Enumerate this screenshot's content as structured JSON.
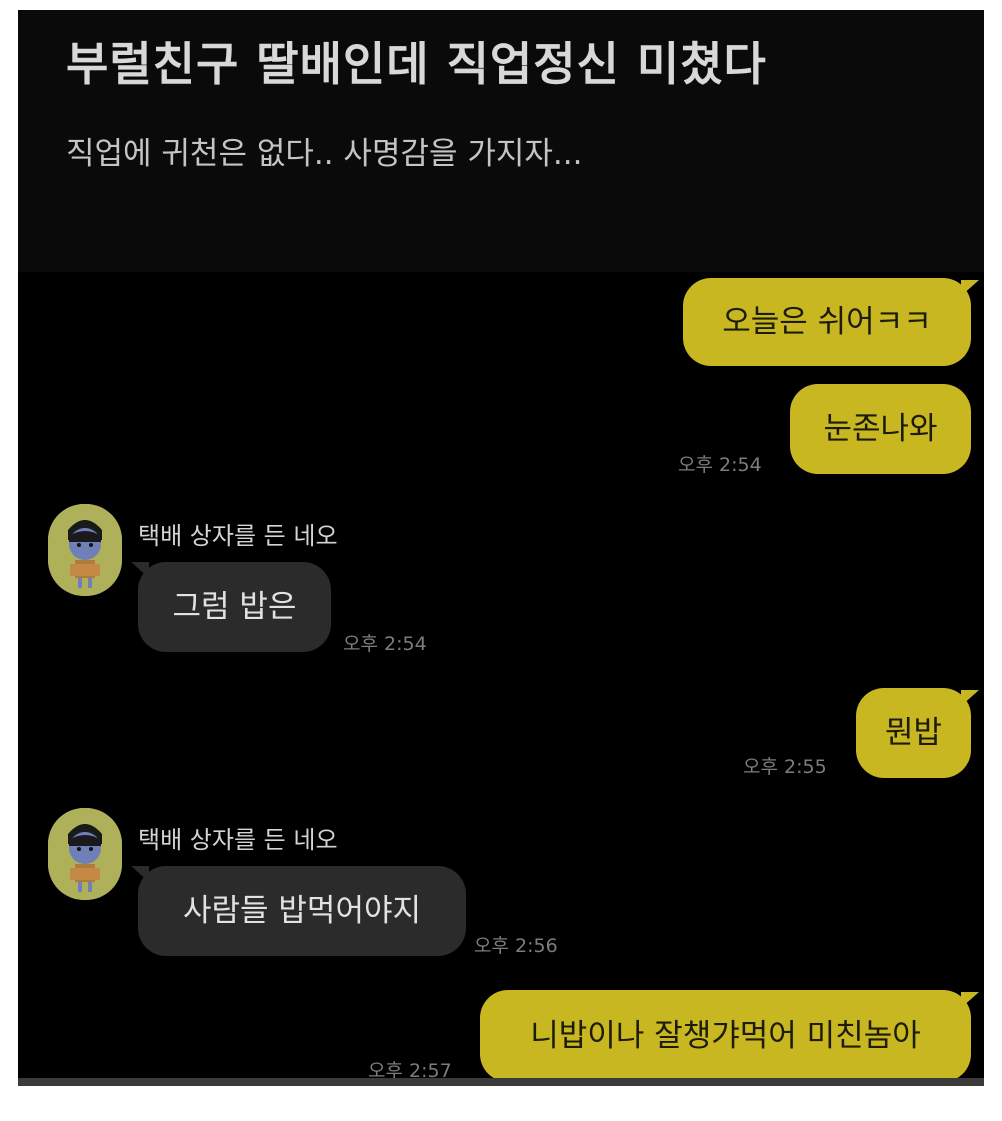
{
  "post": {
    "title": "부럴친구 딸배인데 직업정신 미쳤다",
    "subtitle": "직업에 귀천은 없다.. 사명감을 가지자..."
  },
  "chat": {
    "messages": [
      {
        "from": "me",
        "text": "오늘은 쉬어ㅋㅋ"
      },
      {
        "from": "me",
        "text": "눈존나와",
        "time": "오후 2:54"
      },
      {
        "from": "them",
        "sender": "택배 상자를 든 네오",
        "text": "그럼 밥은",
        "time": "오후 2:54"
      },
      {
        "from": "me",
        "text": "뭔밥",
        "time": "오후 2:55"
      },
      {
        "from": "them",
        "sender": "택배 상자를 든 네오",
        "text": "사람들 밥먹어야지",
        "time": "오후 2:56"
      },
      {
        "from": "me",
        "text": "니밥이나 잘챙갸먹어 미친놈아",
        "time": "오후 2:57"
      }
    ]
  },
  "colors": {
    "background": "#000000",
    "my_bubble": "#c9b722",
    "their_bubble": "#2b2b2b",
    "timestamp": "#7d7d7d"
  },
  "icons": {
    "avatar": "neo-holding-box-avatar"
  }
}
